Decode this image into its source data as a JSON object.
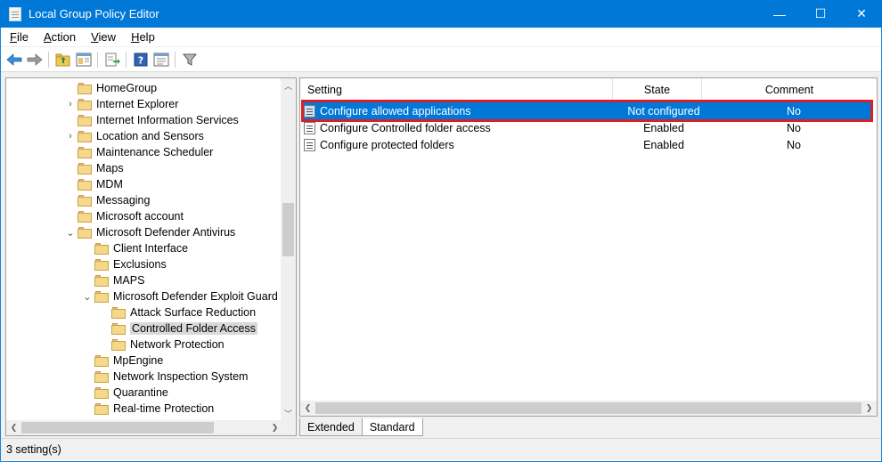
{
  "window": {
    "title": "Local Group Policy Editor",
    "controls": {
      "minimize": "—",
      "maximize": "☐",
      "close": "✕"
    },
    "accent_color": "#0078d7"
  },
  "menubar": [
    {
      "label": "File",
      "mnemonic": "F",
      "rest": "ile"
    },
    {
      "label": "Action",
      "mnemonic": "A",
      "rest": "ction"
    },
    {
      "label": "View",
      "mnemonic": "V",
      "rest": "iew"
    },
    {
      "label": "Help",
      "mnemonic": "H",
      "rest": "elp"
    }
  ],
  "toolbar": {
    "buttons": [
      "back-icon",
      "forward-icon",
      "up-folder-icon",
      "show-hide-tree-icon",
      "export-list-icon",
      "help-icon",
      "properties-icon",
      "filter-icon"
    ]
  },
  "tree": {
    "items": [
      {
        "label": "HomeGroup",
        "expander": ""
      },
      {
        "label": "Internet Explorer",
        "expander": "›"
      },
      {
        "label": "Internet Information Services",
        "expander": ""
      },
      {
        "label": "Location and Sensors",
        "expander": "›"
      },
      {
        "label": "Maintenance Scheduler",
        "expander": ""
      },
      {
        "label": "Maps",
        "expander": ""
      },
      {
        "label": "MDM",
        "expander": ""
      },
      {
        "label": "Messaging",
        "expander": ""
      },
      {
        "label": "Microsoft account",
        "expander": ""
      },
      {
        "label": "Microsoft Defender Antivirus",
        "expander": "⌄"
      },
      {
        "label": "Client Interface",
        "expander": ""
      },
      {
        "label": "Exclusions",
        "expander": ""
      },
      {
        "label": "MAPS",
        "expander": ""
      },
      {
        "label": "Microsoft Defender Exploit Guard",
        "expander": "⌄"
      },
      {
        "label": "Attack Surface Reduction",
        "expander": ""
      },
      {
        "label": "Controlled Folder Access",
        "expander": "",
        "selected": true
      },
      {
        "label": "Network Protection",
        "expander": ""
      },
      {
        "label": "MpEngine",
        "expander": ""
      },
      {
        "label": "Network Inspection System",
        "expander": ""
      },
      {
        "label": "Quarantine",
        "expander": ""
      },
      {
        "label": "Real-time Protection",
        "expander": ""
      }
    ]
  },
  "list": {
    "columns": [
      "Setting",
      "State",
      "Comment"
    ],
    "rows": [
      {
        "setting": "Configure allowed applications",
        "state": "Not configured",
        "comment": "No",
        "selected": true
      },
      {
        "setting": "Configure Controlled folder access",
        "state": "Enabled",
        "comment": "No"
      },
      {
        "setting": "Configure protected folders",
        "state": "Enabled",
        "comment": "No"
      }
    ],
    "highlight_color": "#d8202a"
  },
  "tabs": [
    {
      "label": "Extended",
      "active": false
    },
    {
      "label": "Standard",
      "active": true
    }
  ],
  "status": {
    "text": "3 setting(s)"
  }
}
